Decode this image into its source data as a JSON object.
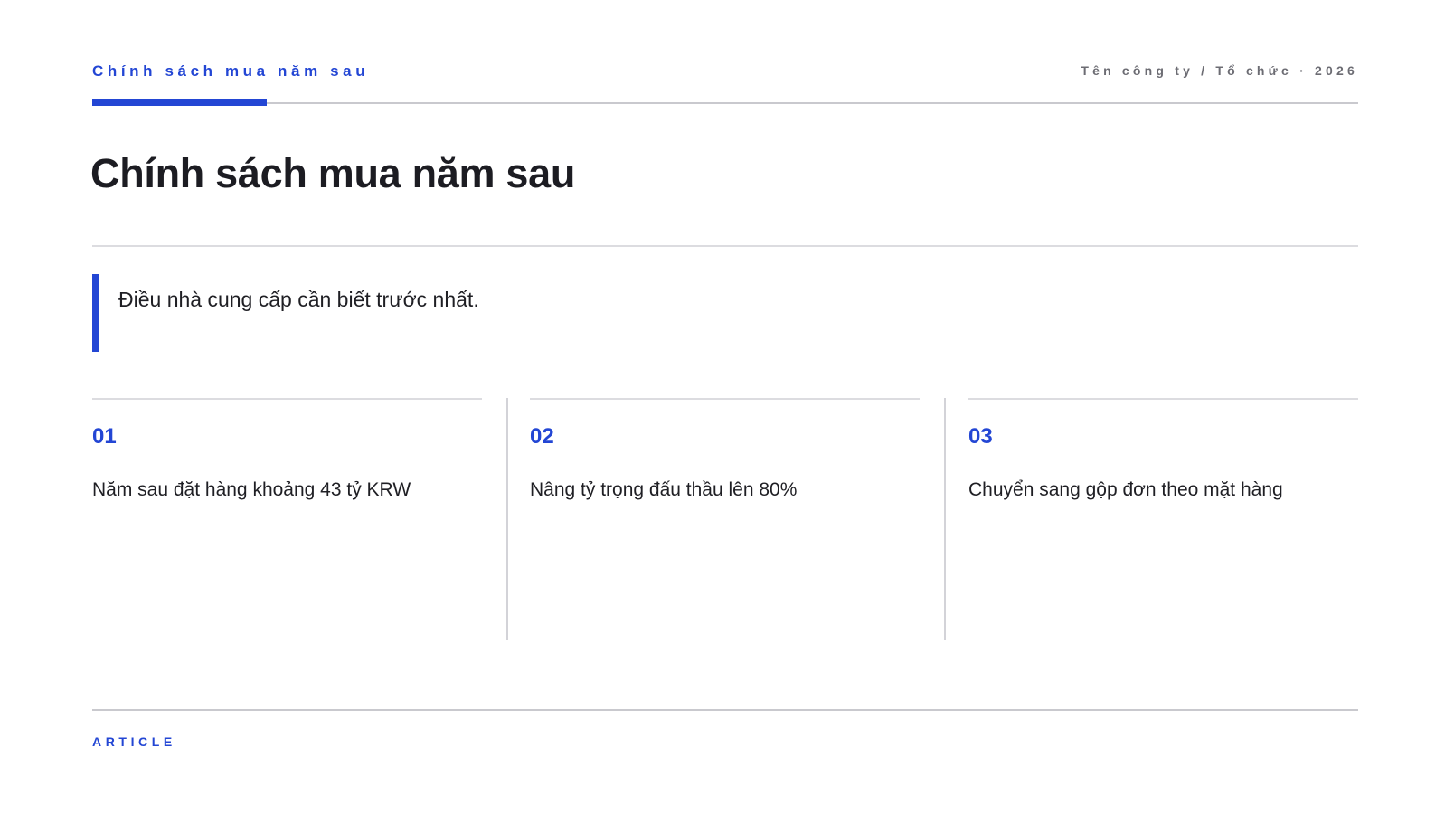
{
  "header": {
    "kicker": "Chính sách mua năm sau",
    "organization": "Tên công ty / Tổ chức · 2026"
  },
  "title": "Chính sách mua năm sau",
  "lead": "Điều nhà cung cấp cần biết trước nhất.",
  "points": [
    {
      "number": "01",
      "text": "Năm sau đặt hàng khoảng 43 tỷ KRW"
    },
    {
      "number": "02",
      "text": "Nâng tỷ trọng đấu thầu lên 80%"
    },
    {
      "number": "03",
      "text": "Chuyển sang gộp đơn theo mặt hàng"
    }
  ],
  "footer": {
    "label": "ARTICLE"
  },
  "colors": {
    "accent": "#2346d4",
    "text": "#1f1f24",
    "muted": "#6c6c73",
    "rule": "#c9c9ce"
  }
}
